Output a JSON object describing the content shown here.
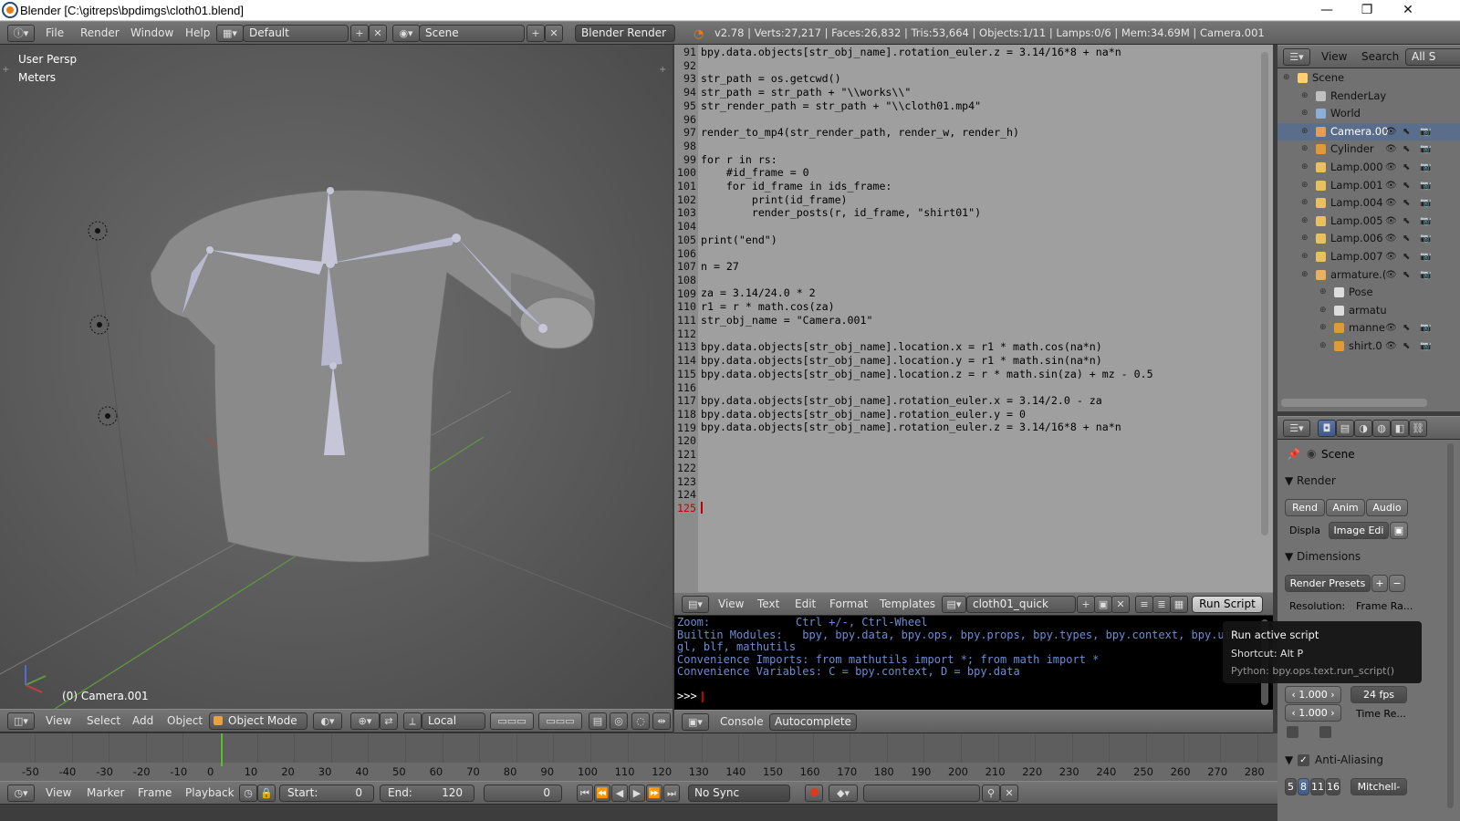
{
  "window": {
    "title": "Blender [C:\\gitreps\\bpdimgs\\cloth01.blend]",
    "minimize": "—",
    "maximize": "❐",
    "close": "✕"
  },
  "info_header": {
    "menus": [
      "File",
      "Render",
      "Window",
      "Help"
    ],
    "screen_layout": "Default",
    "scene": "Scene",
    "render_engine": "Blender Render",
    "stats": "v2.78 | Verts:27,217 | Faces:26,832 | Tris:53,664 | Objects:1/11 | Lamps:0/6 | Mem:34.69M | Camera.001"
  },
  "viewport": {
    "view_name": "User Persp",
    "units": "Meters",
    "object_label": "(0) Camera.001",
    "header": {
      "menus": [
        "View",
        "Select",
        "Add",
        "Object"
      ],
      "mode": "Object Mode",
      "orientation": "Local"
    }
  },
  "text_editor": {
    "line_numbers": [
      "91",
      "92",
      "93",
      "94",
      "95",
      "96",
      "97",
      "98",
      "99",
      "100",
      "101",
      "102",
      "103",
      "104",
      "105",
      "106",
      "107",
      "108",
      "109",
      "110",
      "111",
      "112",
      "113",
      "114",
      "115",
      "116",
      "117",
      "118",
      "119",
      "120",
      "121",
      "122",
      "123",
      "124",
      "125"
    ],
    "lines": [
      "bpy.data.objects[str_obj_name].rotation_euler.z = 3.14/16*8 + na*n",
      "",
      "str_path = os.getcwd()",
      "str_path = str_path + \"\\\\works\\\\\"",
      "str_render_path = str_path + \"\\\\cloth01.mp4\"",
      "",
      "render_to_mp4(str_render_path, render_w, render_h)",
      "",
      "for r in rs:",
      "    #id_frame = 0",
      "    for id_frame in ids_frame:",
      "        print(id_frame)",
      "        render_posts(r, id_frame, \"shirt01\")",
      "",
      "print(\"end\")",
      "",
      "n = 27",
      "",
      "za = 3.14/24.0 * 2",
      "r1 = r * math.cos(za)",
      "str_obj_name = \"Camera.001\"",
      "",
      "bpy.data.objects[str_obj_name].location.x = r1 * math.cos(na*n)",
      "bpy.data.objects[str_obj_name].location.y = r1 * math.sin(na*n)",
      "bpy.data.objects[str_obj_name].location.z = r * math.sin(za) + mz - 0.5",
      "",
      "bpy.data.objects[str_obj_name].rotation_euler.x = 3.14/2.0 - za",
      "bpy.data.objects[str_obj_name].rotation_euler.y = 0",
      "bpy.data.objects[str_obj_name].rotation_euler.z = 3.14/16*8 + na*n",
      "",
      "",
      "",
      "",
      "",
      ""
    ],
    "header": {
      "menus": [
        "View",
        "Text",
        "Edit",
        "Format",
        "Templates"
      ],
      "text_name": "cloth01_quick",
      "run_script": "Run Script"
    }
  },
  "console": {
    "lines": [
      "Zoom:             Ctrl +/-, Ctrl-Wheel",
      "Builtin Modules:   bpy, bpy.data, bpy.ops, bpy.props, bpy.types, bpy.context, bpy.uti",
      "gl, blf, mathutils",
      "Convenience Imports: from mathutils import *; from math import *",
      "Convenience Variables: C = bpy.context, D = bpy.data"
    ],
    "prompt": ">>> ",
    "header": {
      "console": "Console",
      "autocomplete": "Autocomplete"
    }
  },
  "tooltip": {
    "title": "Run active script",
    "shortcut": "Shortcut: Alt P",
    "python": "Python: bpy.ops.text.run_script()"
  },
  "outliner": {
    "header": {
      "view": "View",
      "search": "Search",
      "all": "All S"
    },
    "items": [
      {
        "label": "Scene",
        "indent": 0
      },
      {
        "label": "RenderLay",
        "indent": 1
      },
      {
        "label": "World",
        "indent": 1
      },
      {
        "label": "Camera.00",
        "indent": 1,
        "selected": true
      },
      {
        "label": "Cylinder",
        "indent": 1
      },
      {
        "label": "Lamp.000",
        "indent": 1
      },
      {
        "label": "Lamp.001",
        "indent": 1
      },
      {
        "label": "Lamp.004",
        "indent": 1
      },
      {
        "label": "Lamp.005",
        "indent": 1
      },
      {
        "label": "Lamp.006",
        "indent": 1
      },
      {
        "label": "Lamp.007",
        "indent": 1
      },
      {
        "label": "armature.(",
        "indent": 1
      },
      {
        "label": "Pose",
        "indent": 2
      },
      {
        "label": "armatu",
        "indent": 2
      },
      {
        "label": "manne",
        "indent": 2
      },
      {
        "label": "shirt.0",
        "indent": 2
      }
    ]
  },
  "properties": {
    "scene": "Scene",
    "render_section": "Render",
    "render_buttons": [
      "Rend",
      "Anim",
      "Audio"
    ],
    "display_label": "Displa",
    "display_value": "Image Edi",
    "dimensions_section": "Dimensions",
    "render_presets": "Render Presets",
    "resolution": "Resolution:",
    "frame_range": "Frame Ra...",
    "aspect_x": "1.000",
    "aspect_y": "1.000",
    "fps": "24 fps",
    "time_remap": "Time Re...",
    "antialiasing_section": "Anti-Aliasing",
    "aa_samples": [
      "5",
      "8",
      "11",
      "16"
    ],
    "aa_filter": "Mitchell-"
  },
  "timeline": {
    "ticks": [
      "-50",
      "-40",
      "-30",
      "-20",
      "-10",
      "0",
      "10",
      "20",
      "30",
      "40",
      "50",
      "60",
      "70",
      "80",
      "90",
      "100",
      "110",
      "120",
      "130",
      "140",
      "150",
      "160",
      "170",
      "180",
      "190",
      "200",
      "210",
      "220",
      "230",
      "240",
      "250",
      "260",
      "270",
      "280"
    ],
    "menus": [
      "View",
      "Marker",
      "Frame",
      "Playback"
    ],
    "start_label": "Start:",
    "start": "0",
    "end_label": "End:",
    "end": "120",
    "current": "0",
    "sync": "No Sync"
  }
}
